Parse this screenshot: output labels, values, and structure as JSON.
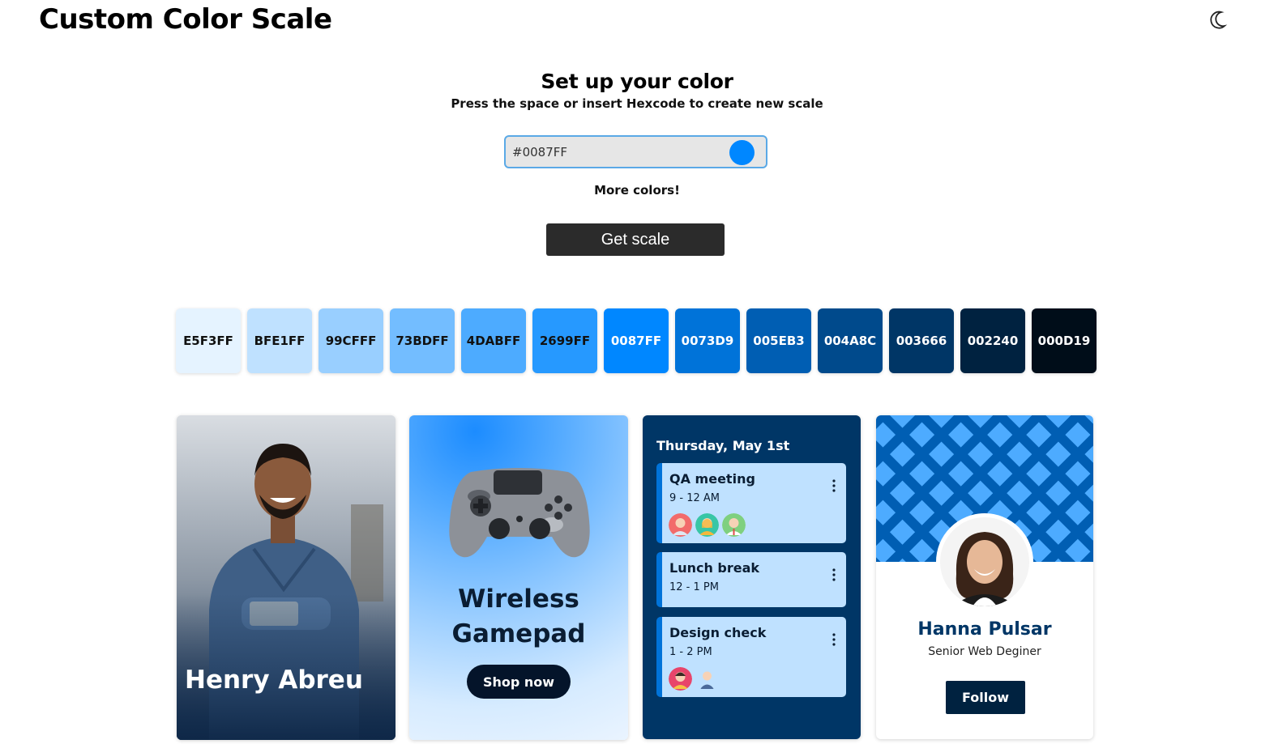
{
  "header": {
    "title": "Custom Color Scale",
    "theme_icon": "moon-icon"
  },
  "setup": {
    "heading": "Set up your color",
    "subheading": "Press the space or insert Hexcode to create new scale",
    "hex_value": "#0087FF",
    "selected_color": "#0087FF",
    "more_colors": "More colors!",
    "get_scale_label": "Get scale"
  },
  "scale": [
    {
      "hex": "E5F3FF",
      "color": "#E5F3FF",
      "text": "#111111"
    },
    {
      "hex": "BFE1FF",
      "color": "#BFE1FF",
      "text": "#111111"
    },
    {
      "hex": "99CFFF",
      "color": "#99CFFF",
      "text": "#111111"
    },
    {
      "hex": "73BDFF",
      "color": "#73BDFF",
      "text": "#111111"
    },
    {
      "hex": "4DABFF",
      "color": "#4DABFF",
      "text": "#111111"
    },
    {
      "hex": "2699FF",
      "color": "#2699FF",
      "text": "#111111"
    },
    {
      "hex": "0087FF",
      "color": "#0087FF",
      "text": "#ffffff"
    },
    {
      "hex": "0073D9",
      "color": "#0073D9",
      "text": "#ffffff"
    },
    {
      "hex": "005EB3",
      "color": "#005EB3",
      "text": "#ffffff"
    },
    {
      "hex": "004A8C",
      "color": "#004A8C",
      "text": "#ffffff"
    },
    {
      "hex": "003666",
      "color": "#003666",
      "text": "#ffffff"
    },
    {
      "hex": "002240",
      "color": "#002240",
      "text": "#ffffff"
    },
    {
      "hex": "000D19",
      "color": "#000D19",
      "text": "#ffffff"
    }
  ],
  "cards": {
    "person": {
      "name": "Henry Abreu"
    },
    "product": {
      "name_line1": "Wireless",
      "name_line2": "Gamepad",
      "button_label": "Shop now"
    },
    "schedule": {
      "date": "Thursday, May 1st",
      "events": [
        {
          "title": "QA meeting",
          "time": "9 - 12 AM"
        },
        {
          "title": "Lunch break",
          "time": "12 - 1 PM"
        },
        {
          "title": "Design check",
          "time": "1 - 2 PM"
        }
      ]
    },
    "profile": {
      "name": "Hanna Pulsar",
      "role": "Senior Web Deginer",
      "button_label": "Follow"
    }
  }
}
